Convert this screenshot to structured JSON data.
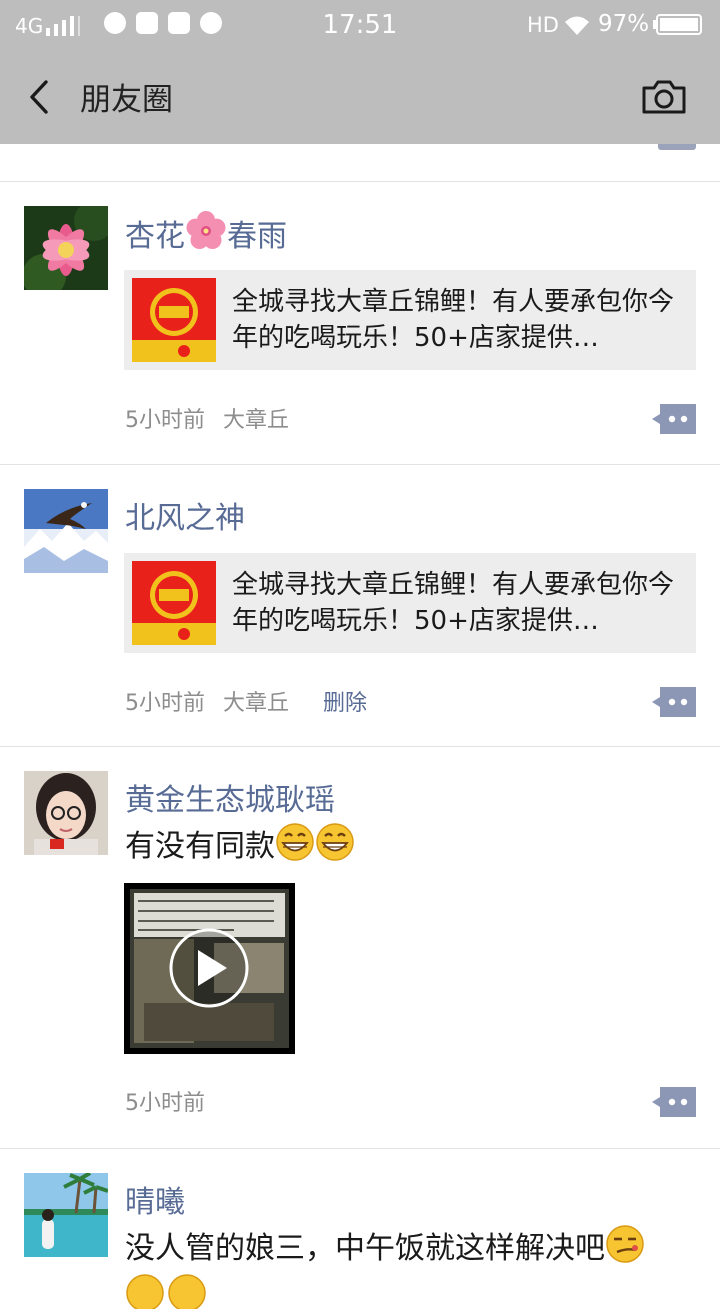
{
  "status_bar": {
    "network": "4G",
    "time": "17:51",
    "hd": "HD",
    "battery": "97%"
  },
  "header": {
    "title": "朋友圈",
    "back_icon": "chevron-left-icon",
    "camera_icon": "camera-icon"
  },
  "posts": [
    {
      "nickname_a": "杏花",
      "nickname_b": "春雨",
      "link_title": "全城寻找大章丘锦鲤！有人要承包你今年的吃喝玩乐！50+店家提供…",
      "time": "5小时前",
      "location": "大章丘"
    },
    {
      "nickname": "北风之神",
      "link_title": "全城寻找大章丘锦鲤！有人要承包你今年的吃喝玩乐！50+店家提供…",
      "time": "5小时前",
      "location": "大章丘",
      "delete": "删除"
    },
    {
      "nickname": "黄金生态城耿瑶",
      "text": "有没有同款",
      "time": "5小时前"
    },
    {
      "nickname": "晴曦",
      "text": "没人管的娘三，中午饭就这样解决吧"
    }
  ],
  "colors": {
    "header_bg": "#bdbdbd",
    "nickname": "#576b95",
    "meta": "#8d8d8d",
    "card_bg": "#ededed"
  }
}
